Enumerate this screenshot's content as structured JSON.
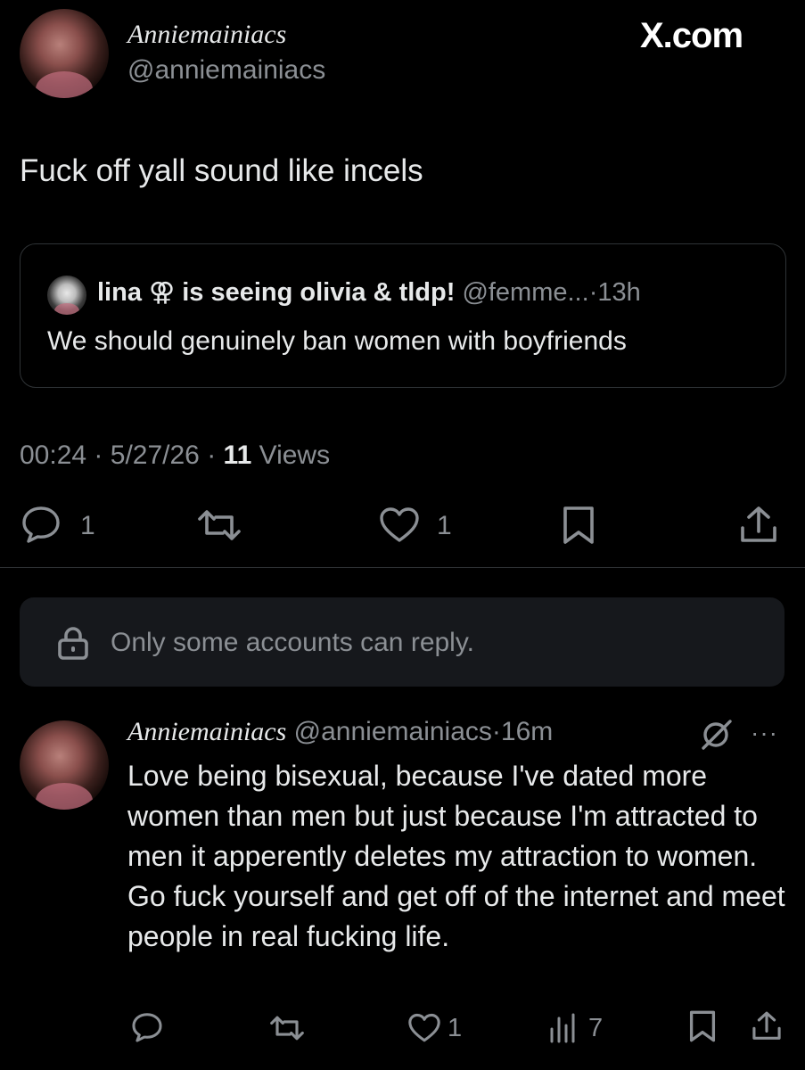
{
  "header": {
    "display_name": "Anniemainiacs",
    "handle": "@anniemainiacs",
    "site": "X.com"
  },
  "post": {
    "text": "Fuck off yall sound like incels",
    "quote": {
      "author": "lina ⚢ is seeing olivia & tldp!",
      "handle": "@femme...",
      "sep": "·",
      "time": "13h",
      "text": "We should genuinely ban women with boyfriends"
    },
    "meta": {
      "time": "00:24",
      "sep1": "·",
      "date": "5/27/26",
      "sep2": "·",
      "views_count": "11",
      "views_label": "Views"
    },
    "actions": {
      "reply_count": "1",
      "like_count": "1"
    }
  },
  "reply_restriction": {
    "text": "Only some accounts can reply."
  },
  "reply": {
    "display_name": "Anniemainiacs",
    "handle": "@anniemainiacs",
    "sep": "·",
    "time": "16m",
    "more": "···",
    "text": "Love being bisexual, because I've dated more women than men but just because I'm attracted to men it apperently deletes my attraction to women. Go fuck yourself and get off of the internet and meet people in real fucking life.",
    "actions": {
      "like_count": "1",
      "views_count": "7"
    }
  },
  "colors": {
    "background": "#000000",
    "text": "#e7e9ea",
    "muted": "#8b8f94",
    "border": "#2f3336",
    "reply_box": "#16181c"
  }
}
